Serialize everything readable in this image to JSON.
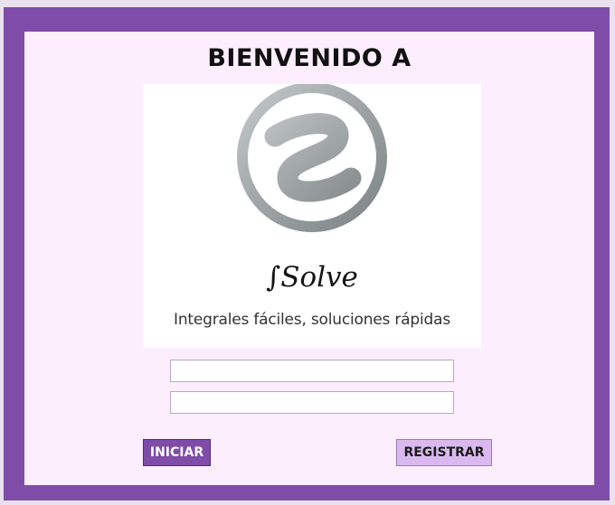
{
  "window": {
    "title": "BIENVENIDO A"
  },
  "logo": {
    "icon": "fsolve-logo-icon",
    "brand": "∫Solve",
    "tagline": "Integrales fáciles, soluciones rápidas"
  },
  "form": {
    "username_value": "",
    "password_value": ""
  },
  "buttons": {
    "login_label": "INICIAR",
    "register_label": "REGISTRAR"
  },
  "colors": {
    "frame": "#7f4da8",
    "panel": "#fdeefe",
    "login_button": "#7f4da8",
    "register_button": "#d9b9ef"
  }
}
